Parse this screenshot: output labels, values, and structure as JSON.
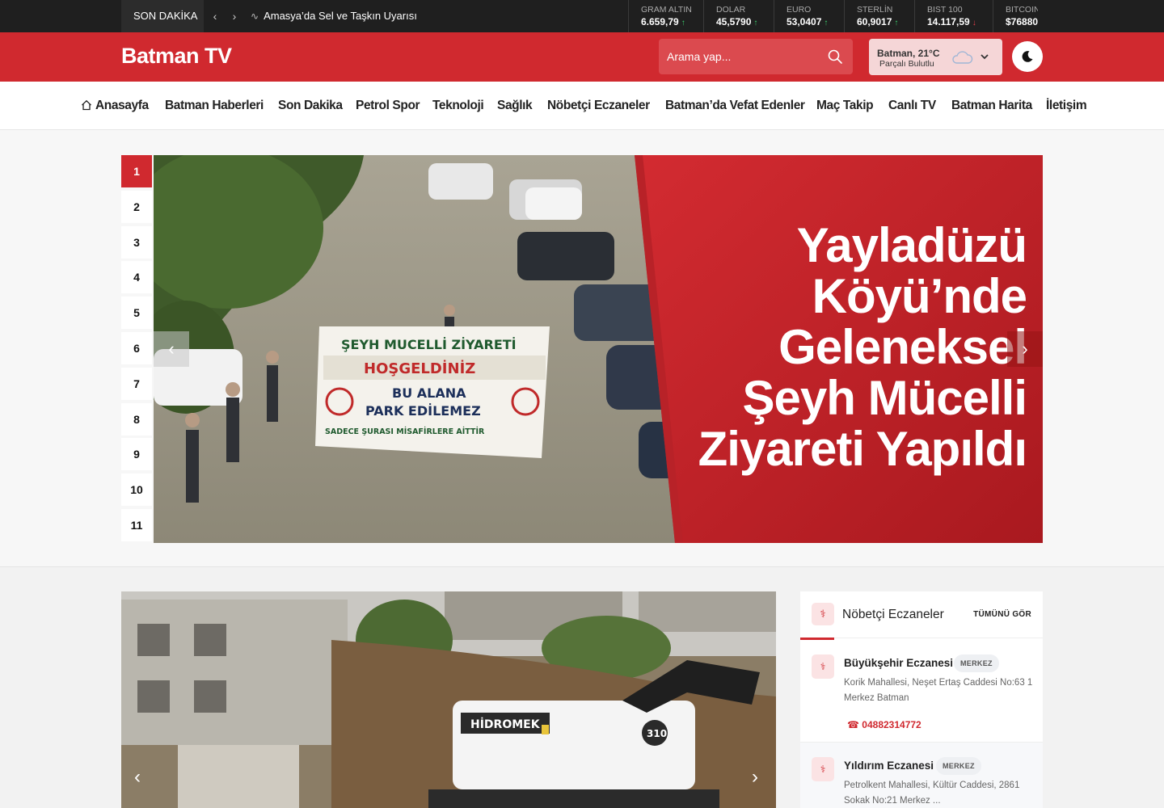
{
  "topbar": {
    "breaking_label": "SON DAKİKA",
    "headline": "Amasya’da Sel ve Taşkın Uyarısı",
    "markets": [
      {
        "label": "GRAM ALTIN",
        "value": "6.659,79",
        "trend": "up"
      },
      {
        "label": "DOLAR",
        "value": "45,5790",
        "trend": "up"
      },
      {
        "label": "EURO",
        "value": "53,0407",
        "trend": "up"
      },
      {
        "label": "STERLİN",
        "value": "60,9017",
        "trend": "up"
      },
      {
        "label": "BIST 100",
        "value": "14.117,59",
        "trend": "down"
      },
      {
        "label": "BITCOIN",
        "value": "$76880",
        "trend": ""
      }
    ]
  },
  "header": {
    "logo": "Batman TV",
    "search_placeholder": "Arama yap...",
    "weather_city": "Batman, 21°C",
    "weather_desc": "Parçalı Bulutlu"
  },
  "nav": [
    "Anasayfa",
    "Batman Haberleri",
    "Son Dakika",
    "Petrol Spor",
    "Teknoloji",
    "Sağlık",
    "Nöbetçi Eczaneler",
    "Batman’da Vefat Edenler",
    "Maç Takip",
    "Canlı TV",
    "Batman Harita",
    "İletişim"
  ],
  "hero": {
    "pages": [
      "1",
      "2",
      "3",
      "4",
      "5",
      "6",
      "7",
      "8",
      "9",
      "10",
      "11"
    ],
    "active_page": "1",
    "title": "Yayladüzü Köyü’nde Geleneksel Şeyh Mücelli Ziyareti Yapıldı",
    "banner_lines": [
      "ŞEYH MUCELLİ ZİYARETİ",
      "HOŞGELDİNİZ",
      "BU ALANA",
      "PARK EDİLEMEZ",
      "SADECE ŞURASI MİSAFİRLERE AİTTİR"
    ]
  },
  "slider2": {
    "machine_brand": "HİDROMEK",
    "machine_model": "310"
  },
  "pharmacies": {
    "title": "Nöbetçi Eczaneler",
    "view_all": "TÜMÜNÜ GÖR",
    "items": [
      {
        "name": "Büyükşehir Eczanesi",
        "badge": "MERKEZ",
        "address": "Korik Mahallesi, Neşet Ertaş Caddesi No:63 1 Merkez Batman",
        "phone": "04882314772"
      },
      {
        "name": "Yıldırım Eczanesi",
        "badge": "MERKEZ",
        "address": "Petrolkent Mahallesi, Kültür Caddesi, 2861 Sokak No:21 Merkez ...",
        "phone": ""
      }
    ]
  },
  "colors": {
    "brand_red": "#d0292f",
    "topbar_bg": "#1f1f1f"
  }
}
